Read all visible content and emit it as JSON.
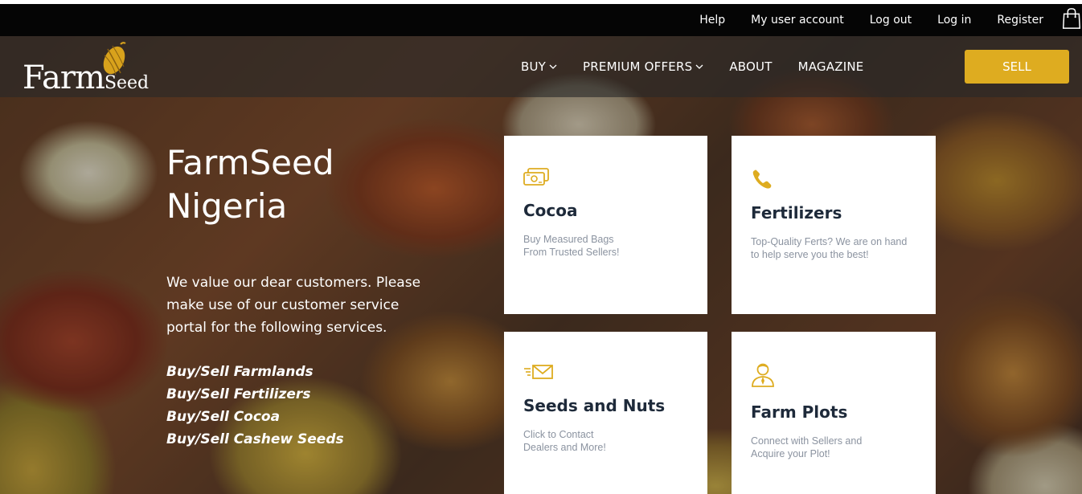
{
  "topbar": {
    "links": [
      "Help",
      "My user account",
      "Log out",
      "Log in",
      "Register"
    ]
  },
  "logo": {
    "main": "Farm",
    "suffix": "Seed"
  },
  "nav": {
    "items": [
      {
        "label": "BUY",
        "dropdown": true
      },
      {
        "label": "PREMIUM OFFERS",
        "dropdown": true
      },
      {
        "label": "ABOUT",
        "dropdown": false
      },
      {
        "label": "MAGAZINE",
        "dropdown": false
      }
    ],
    "sell_label": "SELL"
  },
  "intro": {
    "title_line1": "FarmSeed",
    "title_line2": "Nigeria",
    "description": "We value our dear customers. Please make use of our customer service portal for the following services.",
    "services": [
      "Buy/Sell Farmlands",
      "Buy/Sell Fertilizers",
      "Buy/Sell Cocoa",
      "Buy/Sell Cashew Seeds"
    ]
  },
  "cards": [
    {
      "title": "Cocoa",
      "line1": "Buy Measured Bags",
      "line2": "From Trusted Sellers!",
      "icon": "money-icon"
    },
    {
      "title": "Fertilizers",
      "line1": "Top-Quality Ferts? We are on hand",
      "line2": "to help serve you the best!",
      "icon": "phone-icon"
    },
    {
      "title": "Seeds and Nuts",
      "line1": "Click to Contact",
      "line2": "Dealers and More!",
      "icon": "mail-icon"
    },
    {
      "title": "Farm Plots",
      "line1": "Connect with Sellers and",
      "line2": "Acquire your Plot!",
      "icon": "person-icon"
    }
  ],
  "colors": {
    "accent": "#deac20",
    "topbar": "#050505",
    "card_title": "#1e2a3a",
    "card_text": "#8b93a0"
  }
}
